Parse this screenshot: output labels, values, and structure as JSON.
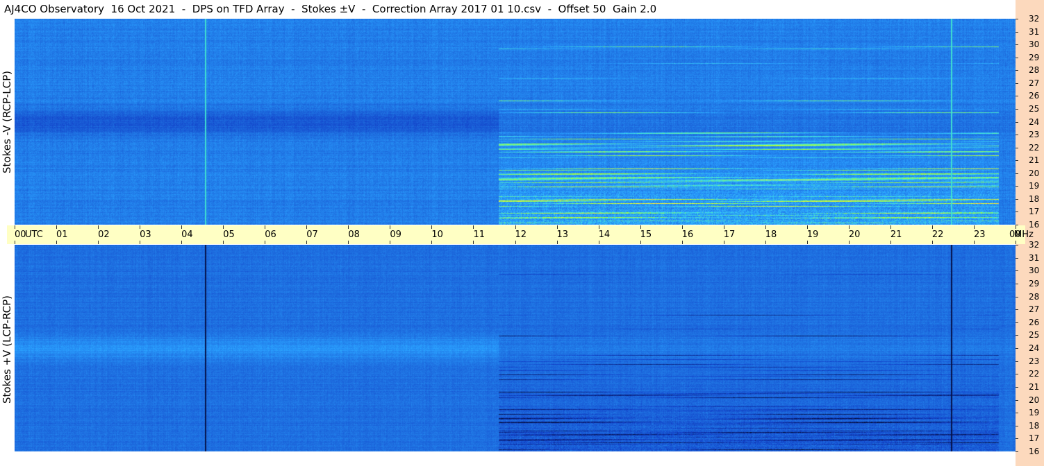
{
  "title": "AJ4CO Observatory  16 Oct 2021  -  DPS on TFD Array  -  Stokes ±V  -  Correction Array 2017 01 10.csv  -  Offset 50  Gain 2.0",
  "colors": {
    "background": "#ffffff",
    "axis_band": "#ffffc4",
    "right_strip": "#fcd9bd",
    "spectrogram_base": "#1e6fe0"
  },
  "chart_data": [
    {
      "type": "heatmap",
      "name": "top-panel",
      "ylabel": "Stokes -V (RCP-LCP)",
      "x": [
        "00",
        "01",
        "02",
        "03",
        "04",
        "05",
        "06",
        "07",
        "08",
        "09",
        "10",
        "11",
        "12",
        "13",
        "14",
        "15",
        "16",
        "17",
        "18",
        "19",
        "20",
        "21",
        "22",
        "23",
        "00"
      ],
      "x_unit": "UTC",
      "xlim": [
        0,
        24
      ],
      "y": [
        16,
        17,
        18,
        19,
        20,
        21,
        22,
        23,
        24,
        25,
        26,
        27,
        28,
        29,
        30,
        31,
        32
      ],
      "y_unit": "MHz",
      "ylim": [
        16,
        32
      ],
      "colormap": [
        "#0a1e6e",
        "#1240c8",
        "#1e6fe0",
        "#2aa0ff",
        "#40e0e0",
        "#a0ff40",
        "#ffff30",
        "#ff4060"
      ],
      "vertical_lines_utc": [
        4.57,
        22.45
      ]
    },
    {
      "type": "heatmap",
      "name": "bottom-panel",
      "ylabel": "Stokes +V (LCP-RCP)",
      "x": [
        "00",
        "01",
        "02",
        "03",
        "04",
        "05",
        "06",
        "07",
        "08",
        "09",
        "10",
        "11",
        "12",
        "13",
        "14",
        "15",
        "16",
        "17",
        "18",
        "19",
        "20",
        "21",
        "22",
        "23",
        "00"
      ],
      "x_unit": "UTC",
      "xlim": [
        0,
        24
      ],
      "y": [
        16,
        17,
        18,
        19,
        20,
        21,
        22,
        23,
        24,
        25,
        26,
        27,
        28,
        29,
        30,
        31,
        32
      ],
      "y_unit": "MHz",
      "ylim": [
        16,
        32
      ],
      "colormap": [
        "#000000",
        "#0a1e6e",
        "#1240c8",
        "#1e6fe0",
        "#2aa0ff",
        "#40e0e0",
        "#a0ff40"
      ],
      "vertical_lines_utc": [
        4.57,
        22.45
      ]
    }
  ],
  "axis": {
    "utc_unit": "UTC",
    "freq_unit": "MHz"
  }
}
